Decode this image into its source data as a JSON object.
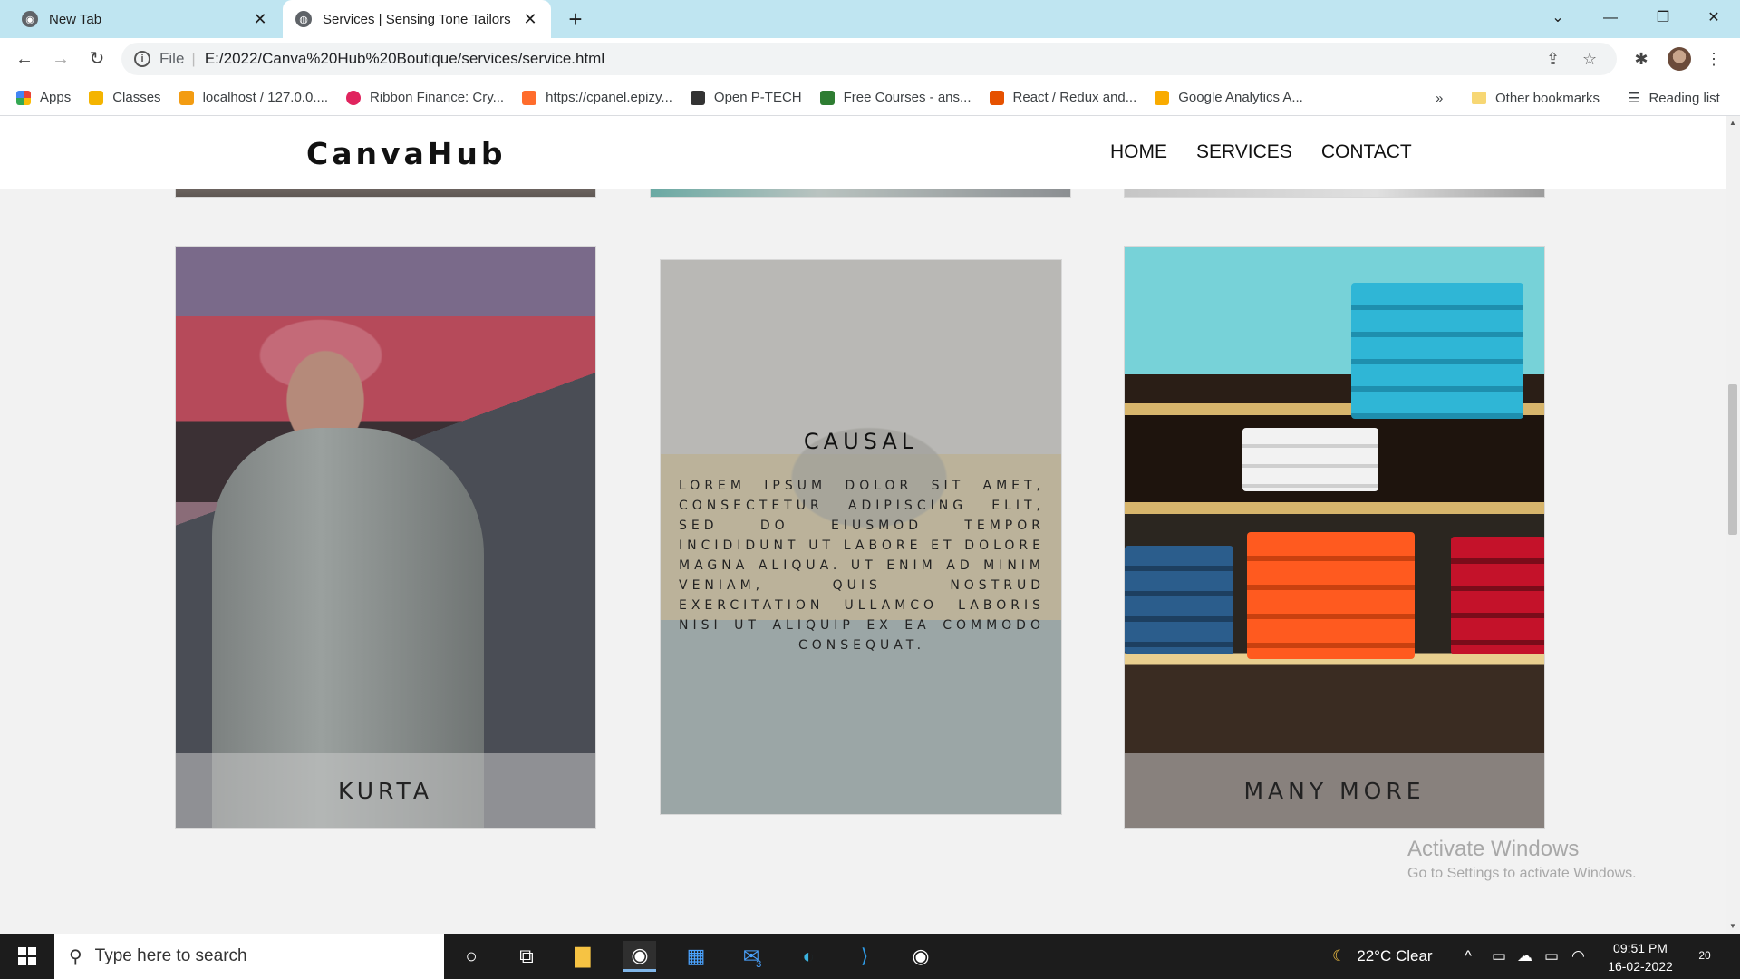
{
  "browser": {
    "tabs": [
      {
        "title": "New Tab",
        "active": false
      },
      {
        "title": "Services | Sensing Tone Tailors",
        "active": true
      }
    ],
    "new_tab_symbol": "+",
    "url_scheme": "File",
    "url": "E:/2022/Canva%20Hub%20Boutique/services/service.html",
    "bookmarks": [
      {
        "label": "Apps",
        "icon": "apps-grid-icon",
        "color": "#e94235"
      },
      {
        "label": "Classes",
        "icon": "classroom-icon",
        "color": "#f4b400"
      },
      {
        "label": "localhost / 127.0.0....",
        "icon": "phpmyadmin-icon",
        "color": "#f39c12"
      },
      {
        "label": "Ribbon Finance: Cry...",
        "icon": "ribbon-icon",
        "color": "#e0245e"
      },
      {
        "label": "https://cpanel.epizy...",
        "icon": "cpanel-icon",
        "color": "#ff6c2c"
      },
      {
        "label": "Open P-TECH",
        "icon": "ptech-icon",
        "color": "#333333"
      },
      {
        "label": "Free Courses - ans...",
        "icon": "courses-icon",
        "color": "#2e7d32"
      },
      {
        "label": "React / Redux and...",
        "icon": "react-icon",
        "color": "#e65100"
      },
      {
        "label": "Google Analytics A...",
        "icon": "analytics-icon",
        "color": "#f9ab00"
      }
    ],
    "overflow": "»",
    "other_bookmarks": "Other bookmarks",
    "reading_list": "Reading list"
  },
  "site": {
    "brand": "CanvaHub",
    "nav": [
      "HOME",
      "SERVICES",
      "CONTACT"
    ],
    "cards": [
      {
        "caption": "KURTA"
      },
      {
        "title": "CAUSAL",
        "text": "LOREM IPSUM DOLOR SIT AMET, CONSECTETUR ADIPISCING ELIT, SED DO EIUSMOD TEMPOR INCIDIDUNT UT LABORE ET DOLORE MAGNA ALIQUA. UT ENIM AD MINIM VENIAM, QUIS NOSTRUD EXERCITATION ULLAMCO LABORIS NISI UT ALIQUIP EX EA COMMODO CONSEQUAT."
      },
      {
        "caption": "MANY MORE"
      }
    ]
  },
  "watermark": {
    "line1": "Activate Windows",
    "line2": "Go to Settings to activate Windows."
  },
  "taskbar": {
    "search_placeholder": "Type here to search",
    "mail_badge": "3",
    "weather": "22°C  Clear",
    "time": "09:51 PM",
    "date": "16-02-2022",
    "notification_count": "20"
  },
  "colors": {
    "tabstrip": "#bfe5f1",
    "taskbar": "#1c1c1c",
    "page_bg": "#f2f2f2"
  }
}
